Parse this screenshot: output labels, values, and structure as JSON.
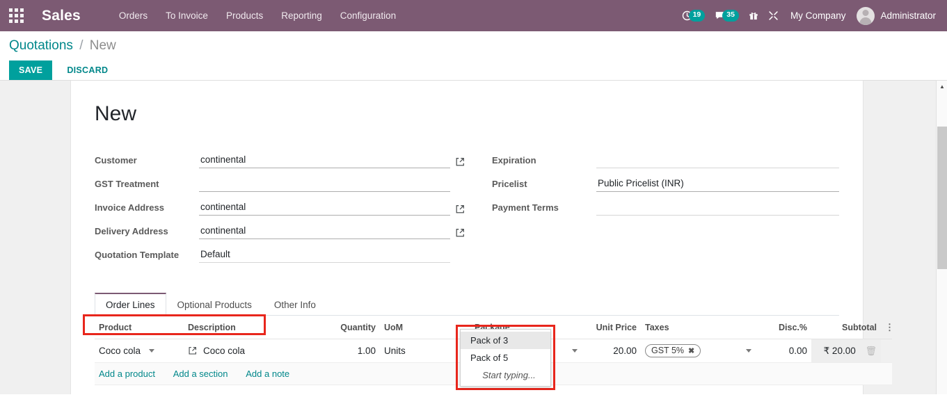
{
  "topbar": {
    "apps_icon": "apps-grid-icon",
    "brand": "Sales",
    "menu": [
      {
        "label": "Orders"
      },
      {
        "label": "To Invoice"
      },
      {
        "label": "Products"
      },
      {
        "label": "Reporting"
      },
      {
        "label": "Configuration"
      }
    ],
    "activities": {
      "icon": "clock-icon",
      "count": "19"
    },
    "messages": {
      "icon": "chat-bubble-icon",
      "count": "35"
    },
    "gift": {
      "icon": "gift-icon"
    },
    "debug": {
      "icon": "bug-wrench-icon"
    },
    "company": "My Company",
    "user": "Administrator",
    "avatar_icon": "user-avatar-icon"
  },
  "breadcrumb": {
    "root": "Quotations",
    "separator": "/",
    "current": "New"
  },
  "actions": {
    "save": "SAVE",
    "discard": "DISCARD"
  },
  "record": {
    "title": "New"
  },
  "form": {
    "left": [
      {
        "label": "Customer",
        "value": "continental",
        "has_ext_link": true
      },
      {
        "label": "GST Treatment",
        "value": "",
        "has_ext_link": false
      },
      {
        "label": "Invoice Address",
        "value": "continental",
        "has_ext_link": true
      },
      {
        "label": "Delivery Address",
        "value": "continental",
        "has_ext_link": true
      },
      {
        "label": "Quotation Template",
        "value": "Default",
        "has_ext_link": false
      }
    ],
    "right": [
      {
        "label": "Expiration",
        "value": ""
      },
      {
        "label": "Pricelist",
        "value": "Public Pricelist (INR)"
      },
      {
        "label": "Payment Terms",
        "value": ""
      }
    ]
  },
  "notebook": {
    "tabs": [
      {
        "label": "Order Lines",
        "active": true
      },
      {
        "label": "Optional Products",
        "active": false
      },
      {
        "label": "Other Info",
        "active": false
      }
    ]
  },
  "order_lines": {
    "columns": [
      "Product",
      "Description",
      "Quantity",
      "UoM",
      "Package",
      "Unit Price",
      "Taxes",
      "Disc.%",
      "Subtotal"
    ],
    "options_icon": "vertical-dots-icon",
    "rows": [
      {
        "product": "Coco cola",
        "description": "Coco cola",
        "quantity": "1.00",
        "uom": "Units",
        "package": "",
        "unit_price": "20.00",
        "tax_tag": "GST 5%",
        "tax_remove": "✖",
        "discount": "0.00",
        "subtotal": "₹ 20.00",
        "delete_icon": "trash-icon"
      }
    ],
    "add_links": [
      {
        "label": "Add a product"
      },
      {
        "label": "Add a section"
      },
      {
        "label": "Add a note"
      }
    ]
  },
  "package_dropdown": {
    "items": [
      {
        "label": "Pack of 3",
        "highlighted": true
      },
      {
        "label": "Pack of 5",
        "highlighted": false
      }
    ],
    "hint": "Start typing..."
  },
  "colors": {
    "brand_purple": "#7c5a73",
    "accent_teal": "#00a09d",
    "link_teal": "#00878a",
    "highlight_red": "#e8261c",
    "badge_teal": "#00a09d"
  },
  "scrollbar": {
    "up_arrow": "▲"
  }
}
